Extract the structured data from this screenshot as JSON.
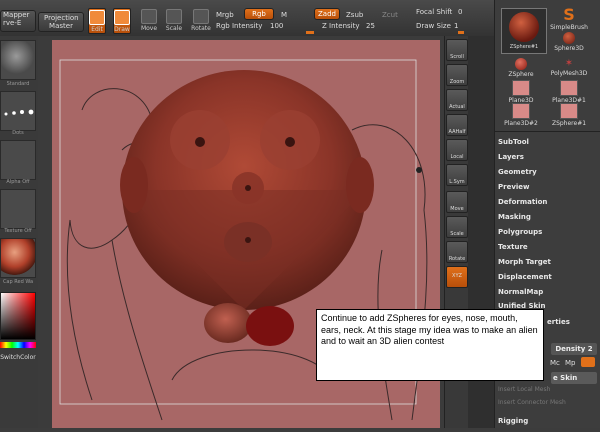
{
  "topbar": {
    "mapper_label": "Mapper",
    "mapper_sub": "rve-E",
    "projection_master": "Projection Master",
    "edit": "Edit",
    "draw": "Draw",
    "move": "Move",
    "scale": "Scale",
    "rotate": "Rotate",
    "mrgb": "Mrgb",
    "rgb": "Rgb",
    "m": "M",
    "rgb_intensity_label": "Rgb Intensity",
    "rgb_intensity_value": "100",
    "zadd": "Zadd",
    "zsub": "Zsub",
    "zcut": "Zcut",
    "z_intensity_label": "Z Intensity",
    "z_intensity_value": "25",
    "focal_shift_label": "Focal Shift",
    "focal_shift_value": "0",
    "draw_size_label": "Draw Size",
    "draw_size_value": "1"
  },
  "lefttray": {
    "items": [
      "Standard",
      "Dots",
      "Alpha Off",
      "Texture Off",
      "Cap Red Wa",
      "SwitchColor"
    ]
  },
  "shelf": {
    "buttons": [
      "Scroll",
      "Zoom",
      "Actual",
      "AAHalf",
      "Local",
      "L.Sym",
      "Move",
      "Scale",
      "Rotate",
      "XYZ"
    ]
  },
  "subtools": {
    "items": [
      "ZSphere#1",
      "SimpleBrush",
      "Sphere3D",
      "ZSphere",
      "PolyMesh3D",
      "Plane3D",
      "Plane3D#1",
      "Plane3D#2",
      "ZSphere#1"
    ]
  },
  "menu": {
    "items": [
      "SubTool",
      "Layers",
      "Geometry",
      "Preview",
      "Deformation",
      "Masking",
      "Polygroups",
      "Texture",
      "Morph Target",
      "Displacement",
      "NormalMap",
      "Unified Skin"
    ],
    "properties": "erties",
    "density_label": "Density 2",
    "mc": "Mc",
    "mp": "Mp",
    "skin_label": "e Skin",
    "insert_local_mesh": "Insert Local Mesh",
    "insert_connector_mesh": "Insert Connector Mesh",
    "rigging": "Rigging"
  },
  "caption": "Continue to add ZSpheres for eyes, nose, mouth, ears, neck. At this stage my idea was to make an alien and to wait an 3D alien contest",
  "colors": {
    "accent_orange": "#e0701a",
    "canvas": "#a86766",
    "head": "#8a3a30"
  }
}
